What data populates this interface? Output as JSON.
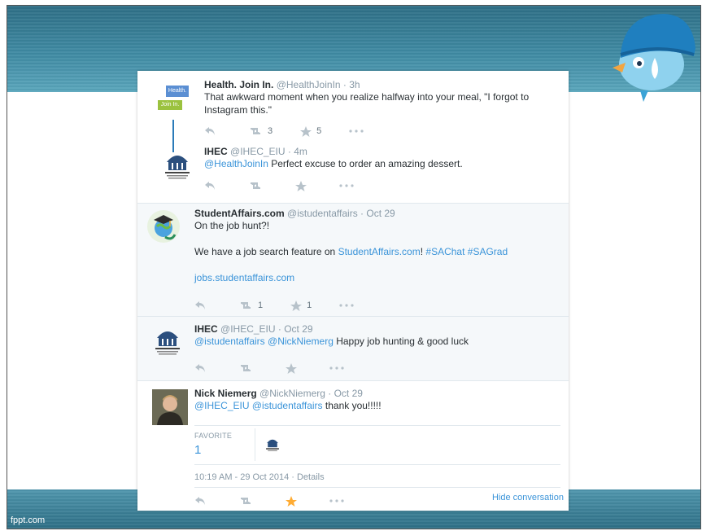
{
  "footer": {
    "brand": "fppt.com"
  },
  "tweets": [
    {
      "name": "Health. Join In.",
      "handle": "@HealthJoinIn",
      "time": "· 3h",
      "text": "That awkward moment when you realize halfway into your meal, \"I forgot to Instagram this.\"",
      "retweets": "3",
      "favorites": "5",
      "avatar_lines": [
        "Health.",
        "Join In."
      ]
    },
    {
      "name": "IHEC",
      "handle": "@IHEC_EIU",
      "time": "· 4m",
      "mention": "@HealthJoinIn",
      "text": " Perfect excuse to order an amazing dessert."
    },
    {
      "name": "StudentAffairs.com",
      "handle": "@istudentaffairs",
      "time": "· Oct 29",
      "line1": "On the job hunt?!",
      "line2_pre": "We have a job search feature on ",
      "line2_link": "StudentAffairs.com",
      "line2_mid": "! ",
      "tag1": "#SAChat",
      "tag2": "#SAGrad",
      "line3_link": "jobs.studentaffairs.com",
      "retweets": "1",
      "favorites": "1"
    },
    {
      "name": "IHEC",
      "handle": "@IHEC_EIU",
      "time": "· Oct 29",
      "mention1": "@istudentaffairs",
      "mention2": "@NickNiemerg",
      "text": " Happy job hunting & good luck"
    },
    {
      "name": "Nick Niemerg",
      "handle": "@NickNiemerg",
      "time": "· Oct 29",
      "mention1": "@IHEC_EIU",
      "mention2": "@istudentaffairs",
      "text": " thank you!!!!!",
      "favorite_label": "FAVORITE",
      "favorite_count": "1",
      "timestamp": "10:19 AM - 29 Oct 2014",
      "details": "· Details",
      "hide": "Hide conversation"
    }
  ],
  "colors": {
    "link": "#3b94d9",
    "star_active": "#ffac33"
  }
}
